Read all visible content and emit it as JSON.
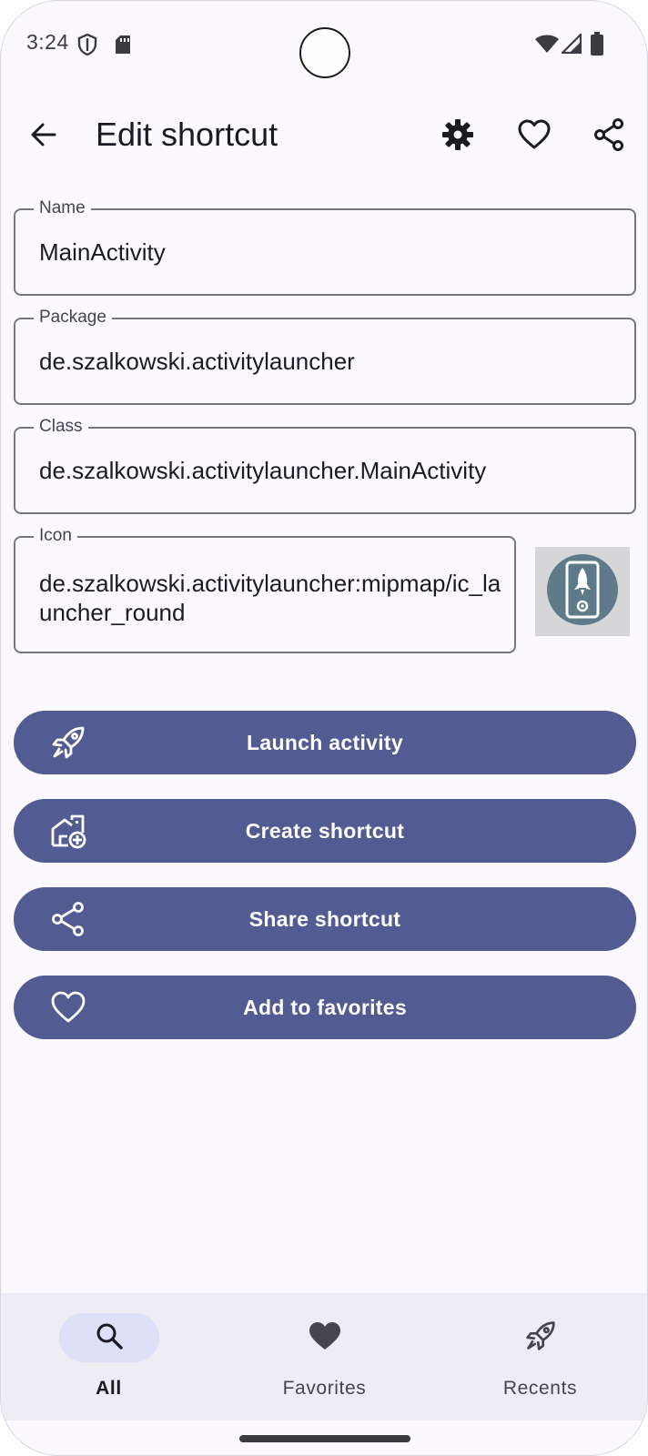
{
  "status_bar": {
    "time": "3:24",
    "icons": [
      "shield-icon",
      "sd-card-icon",
      "wifi-icon",
      "signal-icon",
      "battery-icon"
    ]
  },
  "app_bar": {
    "title": "Edit shortcut",
    "icons": [
      "back-arrow-icon",
      "gear-icon",
      "heart-outline-icon",
      "share-icon"
    ]
  },
  "fields": {
    "name": {
      "label": "Name",
      "value": "MainActivity"
    },
    "package": {
      "label": "Package",
      "value": "de.szalkowski.activitylauncher"
    },
    "class": {
      "label": "Class",
      "value": "de.szalkowski.activitylauncher.MainActivity"
    },
    "icon": {
      "label": "Icon",
      "value": "de.szalkowski.activitylauncher:mipmap/ic_launcher_round"
    }
  },
  "actions": {
    "launch": {
      "label": "Launch activity",
      "icon": "rocket-icon"
    },
    "create": {
      "label": "Create shortcut",
      "icon": "home-add-icon"
    },
    "share": {
      "label": "Share shortcut",
      "icon": "share-icon"
    },
    "favorite": {
      "label": "Add to favorites",
      "icon": "heart-outline-icon"
    }
  },
  "bottom_nav": {
    "items": [
      {
        "label": "All",
        "icon": "search-icon",
        "active": true
      },
      {
        "label": "Favorites",
        "icon": "heart-filled-icon",
        "active": false
      },
      {
        "label": "Recents",
        "icon": "rocket-icon",
        "active": false
      }
    ]
  },
  "colors": {
    "background": "#fbf8ff",
    "primary_button": "#525b92",
    "nav_background": "#efedf4",
    "active_pill": "#dde0f8",
    "outline": "#77767f"
  }
}
